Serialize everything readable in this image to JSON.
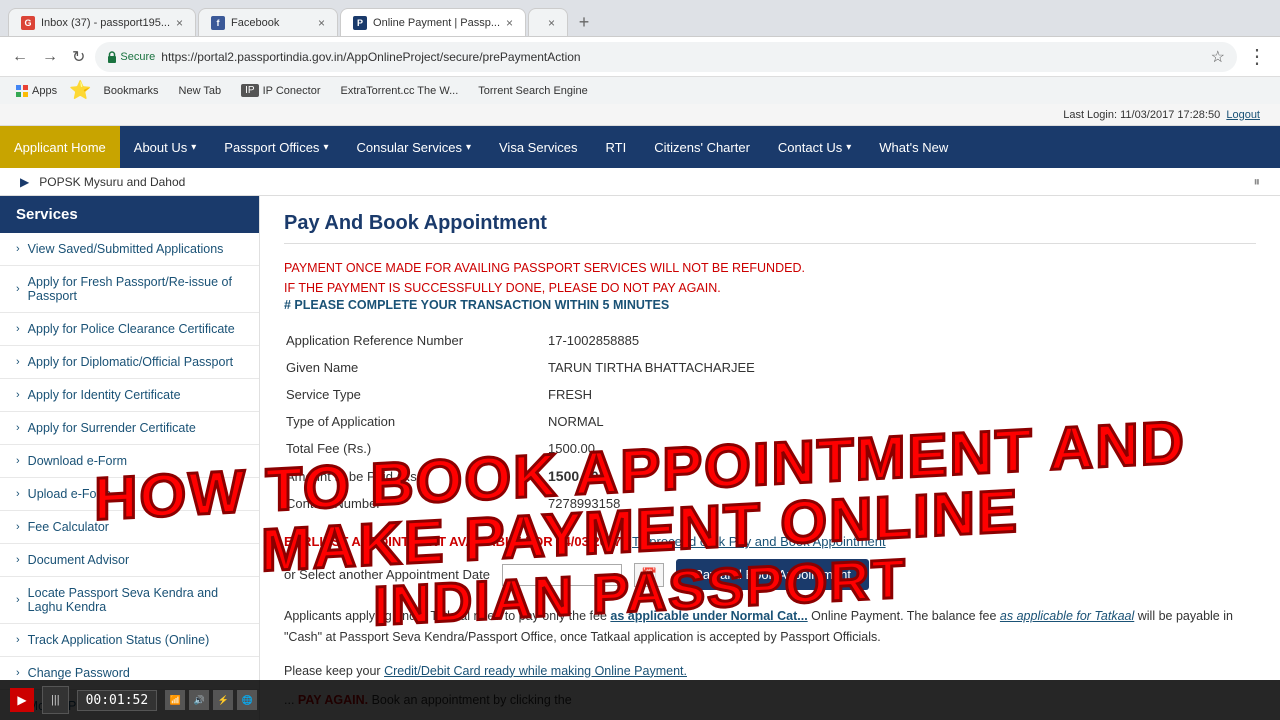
{
  "browser": {
    "tabs": [
      {
        "id": "tab1",
        "title": "Inbox (37) - passport195...",
        "icon_color": "#db4437",
        "icon_label": "G",
        "active": false
      },
      {
        "id": "tab2",
        "title": "Facebook",
        "icon_color": "#3b5998",
        "icon_label": "f",
        "active": false
      },
      {
        "id": "tab3",
        "title": "Online Payment | Passp...",
        "icon_color": "#1a3a6b",
        "icon_label": "P",
        "active": true
      },
      {
        "id": "tab4",
        "title": "",
        "icon_color": "#888",
        "icon_label": "",
        "active": false
      }
    ],
    "address": "https://portal2.passportindia.gov.in/AppOnlineProject/secure/prePaymentAction",
    "secure_label": "Secure"
  },
  "bookmarks": [
    {
      "label": "Apps"
    },
    {
      "label": "Bookmarks"
    },
    {
      "label": "New Tab"
    },
    {
      "label": "IP Conector"
    },
    {
      "label": "ExtraTorrent.cc The W..."
    },
    {
      "label": "Torrent Search Engine"
    }
  ],
  "site": {
    "header_top": {
      "last_login_label": "Last Login:",
      "last_login_value": "11/03/2017 17:28:50",
      "logout_label": "Logout"
    },
    "nav_items": [
      {
        "label": "Applicant Home",
        "active": true,
        "has_dropdown": false
      },
      {
        "label": "About Us",
        "active": false,
        "has_dropdown": true
      },
      {
        "label": "Passport Offices",
        "active": false,
        "has_dropdown": true
      },
      {
        "label": "Consular Services",
        "active": false,
        "has_dropdown": true
      },
      {
        "label": "Visa Services",
        "active": false,
        "has_dropdown": false
      },
      {
        "label": "RTI",
        "active": false,
        "has_dropdown": false
      },
      {
        "label": "Citizens' Charter",
        "active": false,
        "has_dropdown": false
      },
      {
        "label": "Contact Us",
        "active": false,
        "has_dropdown": true
      },
      {
        "label": "What's New",
        "active": false,
        "has_dropdown": false
      }
    ],
    "marquee_text": "POPSK Mysuru and Dahod",
    "sidebar": {
      "title": "Services",
      "items": [
        {
          "label": "View Saved/Submitted Applications"
        },
        {
          "label": "Apply for Fresh Passport/Re-issue of Passport"
        },
        {
          "label": "Apply for Police Clearance Certificate"
        },
        {
          "label": "Apply for Diplomatic/Official Passport"
        },
        {
          "label": "Apply for Identity Certificate"
        },
        {
          "label": "Apply for Surrender Certificate"
        },
        {
          "label": "Download e-Form"
        },
        {
          "label": "Upload e-Form"
        },
        {
          "label": "Fee Calculator"
        },
        {
          "label": "Document Advisor"
        },
        {
          "label": "Locate Passport Seva Kendra and Laghu Kendra"
        },
        {
          "label": "Track Application Status (Online)"
        },
        {
          "label": "Change Password"
        },
        {
          "label": "Modify Profile"
        }
      ]
    },
    "content": {
      "page_title": "Pay And Book Appointment",
      "notices": [
        "PAYMENT ONCE MADE FOR AVAILING PASSPORT SERVICES WILL NOT BE REFUNDED.",
        "IF THE PAYMENT IS SUCCESSFULLY DONE, PLEASE DO NOT PAY AGAIN.",
        "# PLEASE COMPLETE YOUR TRANSACTION WITHIN 5 MINUTES"
      ],
      "fields": [
        {
          "label": "Application Reference Number",
          "value": "17-1002858885"
        },
        {
          "label": "Given Name",
          "value": "TARUN TIRTHA BHATTACHARJEE"
        },
        {
          "label": "Service Type",
          "value": "FRESH"
        },
        {
          "label": "Type of Application",
          "value": "NORMAL"
        },
        {
          "label": "Total Fee (Rs.)",
          "value": "1500.00"
        },
        {
          "label": "Amount to be Paid (Rs.)",
          "value": "1500.00",
          "bold": true
        },
        {
          "label": "Contact Number",
          "value": "7278993158"
        }
      ],
      "appointment_line": "EARLIEST APPOINTMENT AVAILABLE FOR 24/03/2017",
      "appointment_link": "To proceed click Pay and Book Appointment",
      "appointment_or": "or Select another Appointment Date",
      "appointment_button": "Pay and Book Appointment",
      "tatkaal_text1": "Applicants applying under Tatkaal need to pay only the fee",
      "tatkaal_link1": "as applicable under Normal Cat...",
      "tatkaal_text2": "Online Payment. The balance fee",
      "tatkaal_link2": "as applicable for Tatkaal",
      "tatkaal_text3": "will be payable in \"Cash\" at Passport Seva Kendra/Passport Office, once Tatkaal application is accepted by Passport Officials.",
      "payment_note": "Please keep your Credit/Debit Card ready while making Online Payment.",
      "success_note": "Book an appointment by clicking the"
    }
  },
  "overlay": {
    "line1": "HOW TO BOOK APPOINTMENT AND MAKE PAYMENT ONLINE",
    "line2": "INDIAN PASSPORT"
  },
  "bottom_bar": {
    "clock": "00:01:52"
  }
}
